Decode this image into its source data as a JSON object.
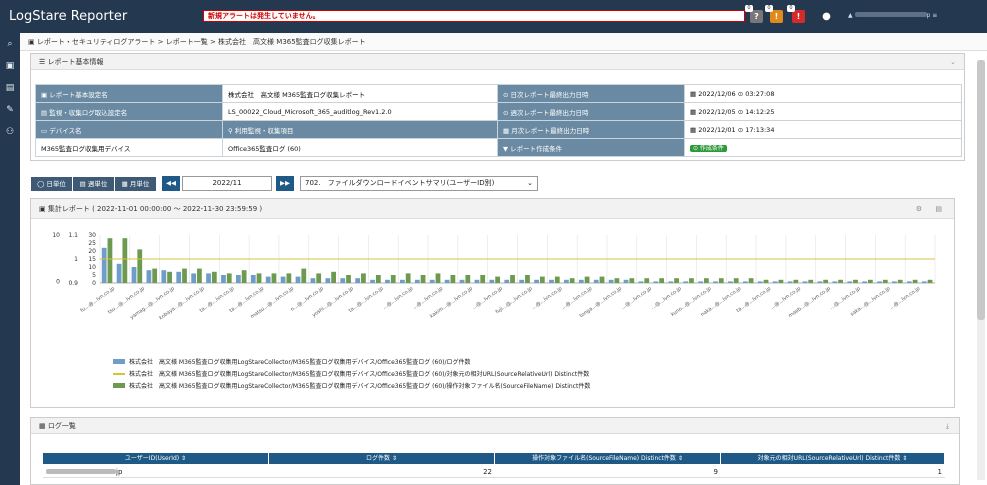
{
  "app": {
    "title": "LogStare Reporter",
    "alert_text": "新規アラートは発生していません。",
    "badges": [
      "0",
      "0",
      "0"
    ],
    "user_suffix": "p"
  },
  "breadcrumb": "レポート・セキュリティログアラート > レポート一覧 > 株式会社　高文様 M365監査ログ収集レポート",
  "basic": {
    "title": "レポート基本情報",
    "labels": {
      "name": "レポート基本設定名",
      "log_setting": "監視・収集ログ取込設定名",
      "device": "デバイス名",
      "item": "利用監視・収集項目",
      "daily": "日次レポート最終出力日時",
      "weekly": "週次レポート最終出力日時",
      "monthly": "月次レポート最終出力日時",
      "condition": "レポート作成条件"
    },
    "values": {
      "name": "株式会社　高文様 M365監査ログ収集レポート",
      "log_setting": "LS_00022_Cloud_Microsoft_365_auditlog_Rev1.2.0",
      "device": "M365監査ログ収集用デバイス",
      "item": "Office365監査ログ (60)",
      "daily": "2022/12/06 ⊙ 03:27:08",
      "weekly": "2022/12/05 ⊙ 14:12:25",
      "monthly": "2022/12/01 ⊙ 17:13:34",
      "condition_btn": "⊙ 作成条件"
    }
  },
  "controls": {
    "daily": "◯ 日単位",
    "weekly": "▤ 週単位",
    "monthly": "▦ 月単位",
    "prev": "◀◀",
    "month": "2022/11",
    "next": "▶▶",
    "report_select": "702.　ファイルダウンロードイベントサマリ(ユーザーID別)"
  },
  "chart_title": "集計レポート ( 2022-11-01 00:00:00 ～ 2022-11-30 23:59:59 )",
  "grid": {
    "title": "ログ一覧",
    "headers": [
      "ユーザーID(UserId)",
      "ログ件数",
      "操作対象ファイル名(SourceFileName) Distinct件数",
      "対象元の相対URL(SourceRelativeUrl) Distinct件数"
    ],
    "row": [
      "jp",
      "22",
      "9",
      "1"
    ]
  },
  "chart_data": {
    "type": "bar",
    "axes": {
      "y1_ticks": [
        "10",
        "0"
      ],
      "y2_ticks": [
        "1.1",
        "1",
        "0.9"
      ],
      "y3_ticks": [
        "30",
        "25",
        "20",
        "15",
        "10",
        "5",
        "0"
      ]
    },
    "x_labels": [
      "fu...@...lvn.co.jp",
      "tsu...@...lvn.co.jp",
      "yamag...@...lvn.co.jp",
      "kobaya...@...lvn.co.jp",
      "ta...@...lvn.co.jp",
      "ta...@...lvn.co.jp",
      "matsu...@...lvn.co.jp",
      "n...@...lvn.co.jp",
      "yoshi...@...lvn.co.jp",
      "ta...@...lvn.co.jp",
      "...@...lvn.co.jp",
      "...@...lvn.co.jp",
      "kakim...@...lvn.co.jp",
      "...@...lvn.co.jp",
      "fuji...@...lvn.co.jp",
      "...@...lvn.co.jp",
      "...@...lvn.co.jp",
      "tonga...@...lvn.co.jp",
      "...@...lvn.co.jp",
      "...@...lvn.co.jp",
      "kuno...@...lvn.co.jp",
      "naka...@...lvn.co.jp",
      "ta...@...lvn.co.jp",
      "...@...lvn.co.jp",
      "maeb...@...lvn.co.jp",
      "...@...lvn.co.jp",
      "saka...@...lvn.co.jp",
      "...@...lvn.co.jp"
    ],
    "series": [
      {
        "name": "株式会社　高文様 M365監査ログ収集用LogStareCollector/M365監査ログ収集用デバイス/Office365監査ログ (60)/ログ件数",
        "color": "#6e9ec8",
        "values": [
          22,
          12,
          10,
          8,
          8,
          7,
          6,
          6,
          5,
          5,
          5,
          4,
          4,
          4,
          3,
          3,
          3,
          3,
          2,
          2,
          2,
          2,
          2,
          2,
          2,
          2,
          2,
          2,
          2,
          2,
          2,
          2,
          2,
          2,
          2,
          2,
          1,
          1,
          1,
          1,
          1,
          1,
          1,
          1,
          1,
          1,
          1,
          1,
          1,
          1,
          1,
          1,
          1,
          1,
          1,
          1
        ]
      },
      {
        "name": "株式会社　高文様 M365監査ログ収集用LogStareCollector/M365監査ログ収集用デバイス/Office365監査ログ (60)/対象元の相対URL(SourceRelativeUrl) Distinct件数",
        "color": "#d6c33a",
        "values": [
          1
        ]
      },
      {
        "name": "株式会社　高文様 M365監査ログ収集用LogStareCollector/M365監査ログ収集用デバイス/Office365監査ログ (60)/操作対象ファイル名(SourceFileName) Distinct件数",
        "color": "#6d9a4f",
        "values": [
          28,
          28,
          21,
          9,
          7,
          9,
          9,
          7,
          6,
          8,
          6,
          6,
          6,
          9,
          6,
          7,
          5,
          6,
          5,
          5,
          6,
          5,
          6,
          5,
          5,
          5,
          4,
          5,
          5,
          4,
          4,
          3,
          4,
          4,
          3,
          3,
          3,
          3,
          3,
          3,
          3,
          3,
          3,
          3,
          2,
          2,
          2,
          2,
          2,
          2,
          2,
          2,
          2,
          2,
          2,
          2
        ]
      }
    ]
  }
}
